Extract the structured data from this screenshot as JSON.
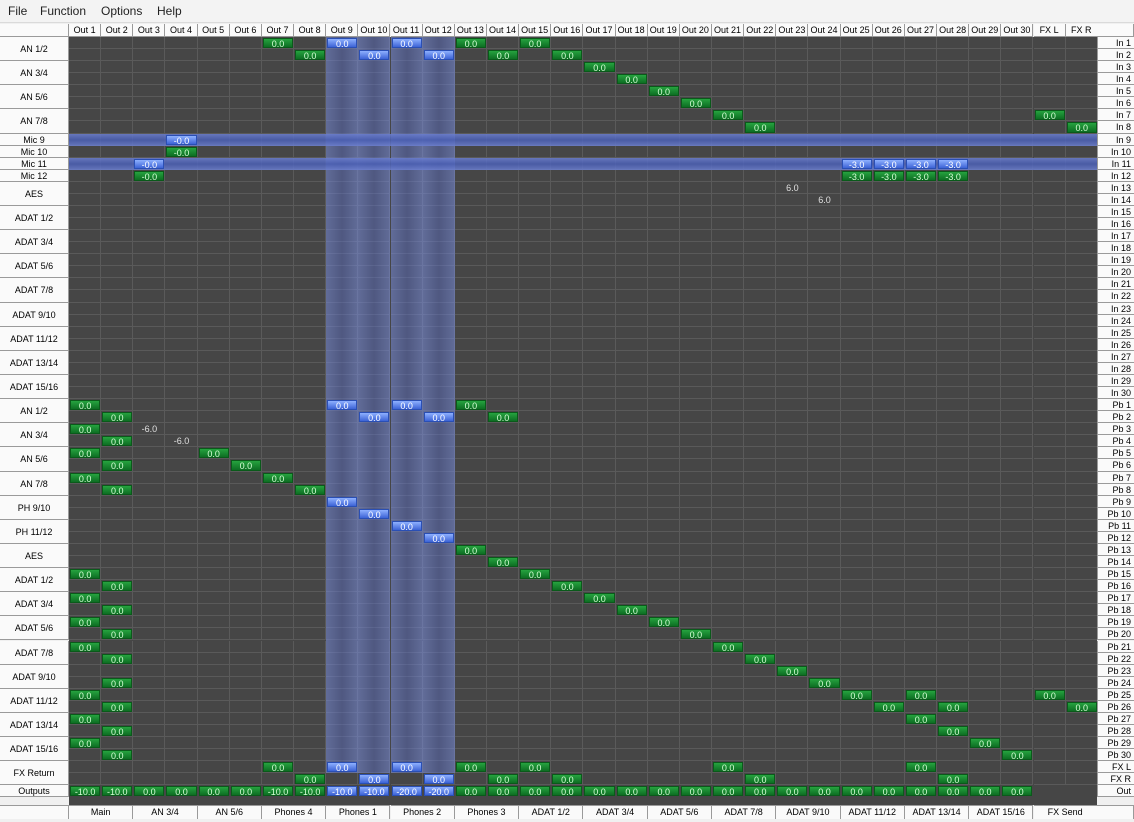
{
  "menu": [
    "File",
    "Function",
    "Options",
    "Help"
  ],
  "outputs": [
    "Out 1",
    "Out 2",
    "Out 3",
    "Out 4",
    "Out 5",
    "Out 6",
    "Out 7",
    "Out 8",
    "Out 9",
    "Out 10",
    "Out 11",
    "Out 12",
    "Out 13",
    "Out 14",
    "Out 15",
    "Out 16",
    "Out 17",
    "Out 18",
    "Out 19",
    "Out 20",
    "Out 21",
    "Out 22",
    "Out 23",
    "Out 24",
    "Out 25",
    "Out 26",
    "Out 27",
    "Out 28",
    "Out 29",
    "Out 30",
    "FX L",
    "FX R"
  ],
  "input_groups": [
    "AN 1/2",
    "AN 3/4",
    "AN 5/6",
    "AN 7/8",
    "Mic 9",
    "Mic 10",
    "Mic 11",
    "Mic 12",
    "AES",
    "ADAT 1/2",
    "ADAT 3/4",
    "ADAT 5/6",
    "ADAT 7/8",
    "ADAT 9/10",
    "ADAT 11/12",
    "ADAT 13/14",
    "ADAT 15/16"
  ],
  "playback_groups": [
    "AN 1/2",
    "AN 3/4",
    "AN 5/6",
    "AN 7/8",
    "PH 9/10",
    "PH 11/12",
    "AES",
    "ADAT 1/2",
    "ADAT 3/4",
    "ADAT 5/6",
    "ADAT 7/8",
    "ADAT 9/10",
    "ADAT 11/12",
    "ADAT 13/14",
    "ADAT 15/16"
  ],
  "fx_return_label": "FX Return",
  "outputs_label": "Outputs",
  "in_rows": [
    "In 1",
    "In 2",
    "In 3",
    "In 4",
    "In 5",
    "In 6",
    "In 7",
    "In 8",
    "In 9",
    "In 10",
    "In 11",
    "In 12",
    "In 13",
    "In 14",
    "In 15",
    "In 16",
    "In 17",
    "In 18",
    "In 19",
    "In 20",
    "In 21",
    "In 22",
    "In 23",
    "In 24",
    "In 25",
    "In 26",
    "In 27",
    "In 28",
    "In 29",
    "In 30"
  ],
  "pb_rows": [
    "Pb 1",
    "Pb 2",
    "Pb 3",
    "Pb 4",
    "Pb 5",
    "Pb 6",
    "Pb 7",
    "Pb 8",
    "Pb 9",
    "Pb 10",
    "Pb 11",
    "Pb 12",
    "Pb 13",
    "Pb 14",
    "Pb 15",
    "Pb 16",
    "Pb 17",
    "Pb 18",
    "Pb 19",
    "Pb 20",
    "Pb 21",
    "Pb 22",
    "Pb 23",
    "Pb 24",
    "Pb 25",
    "Pb 26",
    "Pb 27",
    "Pb 28",
    "Pb 29",
    "Pb 30"
  ],
  "fx_rows": [
    "FX L",
    "FX R"
  ],
  "out_row_label": "Out",
  "output_levels": [
    "-10.0",
    "-10.0",
    "0.0",
    "0.0",
    "0.0",
    "0.0",
    "-10.0",
    "-10.0",
    "-10.0",
    "-10.0",
    "-20.0",
    "-20.0",
    "0.0",
    "0.0",
    "0.0",
    "0.0",
    "0.0",
    "0.0",
    "0.0",
    "0.0",
    "0.0",
    "0.0",
    "0.0",
    "0.0",
    "0.0",
    "0.0",
    "0.0",
    "0.0",
    "0.0",
    "0.0"
  ],
  "bottom_groups": [
    "Main",
    "AN 3/4",
    "AN 5/6",
    "Phones 4",
    "Phones 1",
    "Phones 2",
    "Phones 3",
    "ADAT 1/2",
    "ADAT 3/4",
    "ADAT 5/6",
    "ADAT 7/8",
    "ADAT 9/10",
    "ADAT 11/12",
    "ADAT 13/14",
    "ADAT 15/16",
    "FX Send"
  ],
  "highlighted_output_columns": [
    9,
    10,
    11,
    12
  ],
  "highlighted_input_rows": [
    "In 9",
    "In 11"
  ],
  "gains": [
    {
      "row": "In 1",
      "col": 7,
      "val": "0.0"
    },
    {
      "row": "In 1",
      "col": 9,
      "val": "0.0"
    },
    {
      "row": "In 1",
      "col": 11,
      "val": "0.0"
    },
    {
      "row": "In 1",
      "col": 13,
      "val": "0.0"
    },
    {
      "row": "In 1",
      "col": 15,
      "val": "0.0"
    },
    {
      "row": "In 2",
      "col": 8,
      "val": "0.0"
    },
    {
      "row": "In 2",
      "col": 10,
      "val": "0.0"
    },
    {
      "row": "In 2",
      "col": 12,
      "val": "0.0"
    },
    {
      "row": "In 2",
      "col": 14,
      "val": "0.0"
    },
    {
      "row": "In 2",
      "col": 16,
      "val": "0.0"
    },
    {
      "row": "In 3",
      "col": 17,
      "val": "0.0"
    },
    {
      "row": "In 4",
      "col": 18,
      "val": "0.0"
    },
    {
      "row": "In 5",
      "col": 19,
      "val": "0.0"
    },
    {
      "row": "In 6",
      "col": 20,
      "val": "0.0"
    },
    {
      "row": "In 7",
      "col": 21,
      "val": "0.0"
    },
    {
      "row": "In 7",
      "col": 31,
      "val": "0.0"
    },
    {
      "row": "In 8",
      "col": 22,
      "val": "0.0"
    },
    {
      "row": "In 8",
      "col": 32,
      "val": "0.0"
    },
    {
      "row": "In 9",
      "col": 4,
      "val": "-0.0"
    },
    {
      "row": "In 10",
      "col": 4,
      "val": "-0.0"
    },
    {
      "row": "In 11",
      "col": 3,
      "val": "-0.0"
    },
    {
      "row": "In 11",
      "col": 25,
      "val": "-3.0"
    },
    {
      "row": "In 11",
      "col": 26,
      "val": "-3.0"
    },
    {
      "row": "In 11",
      "col": 27,
      "val": "-3.0"
    },
    {
      "row": "In 11",
      "col": 28,
      "val": "-3.0"
    },
    {
      "row": "In 12",
      "col": 3,
      "val": "-0.0"
    },
    {
      "row": "In 12",
      "col": 25,
      "val": "-3.0"
    },
    {
      "row": "In 12",
      "col": 26,
      "val": "-3.0"
    },
    {
      "row": "In 12",
      "col": 27,
      "val": "-3.0"
    },
    {
      "row": "In 12",
      "col": 28,
      "val": "-3.0"
    },
    {
      "row": "In 13",
      "col": 23,
      "val": "6.0"
    },
    {
      "row": "In 14",
      "col": 24,
      "val": "6.0"
    },
    {
      "row": "Pb 1",
      "col": 1,
      "val": "0.0"
    },
    {
      "row": "Pb 1",
      "col": 9,
      "val": "0.0"
    },
    {
      "row": "Pb 1",
      "col": 11,
      "val": "0.0"
    },
    {
      "row": "Pb 1",
      "col": 13,
      "val": "0.0"
    },
    {
      "row": "Pb 2",
      "col": 2,
      "val": "0.0"
    },
    {
      "row": "Pb 2",
      "col": 10,
      "val": "0.0"
    },
    {
      "row": "Pb 2",
      "col": 12,
      "val": "0.0"
    },
    {
      "row": "Pb 2",
      "col": 14,
      "val": "0.0"
    },
    {
      "row": "Pb 3",
      "col": 1,
      "val": "0.0"
    },
    {
      "row": "Pb 3",
      "col": 3,
      "val": "-6.0"
    },
    {
      "row": "Pb 4",
      "col": 2,
      "val": "0.0"
    },
    {
      "row": "Pb 4",
      "col": 4,
      "val": "-6.0"
    },
    {
      "row": "Pb 5",
      "col": 1,
      "val": "0.0"
    },
    {
      "row": "Pb 5",
      "col": 5,
      "val": "0.0"
    },
    {
      "row": "Pb 6",
      "col": 2,
      "val": "0.0"
    },
    {
      "row": "Pb 6",
      "col": 6,
      "val": "0.0"
    },
    {
      "row": "Pb 7",
      "col": 1,
      "val": "0.0"
    },
    {
      "row": "Pb 7",
      "col": 7,
      "val": "0.0"
    },
    {
      "row": "Pb 8",
      "col": 2,
      "val": "0.0"
    },
    {
      "row": "Pb 8",
      "col": 8,
      "val": "0.0"
    },
    {
      "row": "Pb 9",
      "col": 9,
      "val": "0.0"
    },
    {
      "row": "Pb 10",
      "col": 10,
      "val": "0.0"
    },
    {
      "row": "Pb 11",
      "col": 11,
      "val": "0.0"
    },
    {
      "row": "Pb 12",
      "col": 12,
      "val": "0.0"
    },
    {
      "row": "Pb 13",
      "col": 13,
      "val": "0.0"
    },
    {
      "row": "Pb 14",
      "col": 14,
      "val": "0.0"
    },
    {
      "row": "Pb 15",
      "col": 1,
      "val": "0.0"
    },
    {
      "row": "Pb 15",
      "col": 15,
      "val": "0.0"
    },
    {
      "row": "Pb 16",
      "col": 2,
      "val": "0.0"
    },
    {
      "row": "Pb 16",
      "col": 16,
      "val": "0.0"
    },
    {
      "row": "Pb 17",
      "col": 1,
      "val": "0.0"
    },
    {
      "row": "Pb 17",
      "col": 17,
      "val": "0.0"
    },
    {
      "row": "Pb 18",
      "col": 2,
      "val": "0.0"
    },
    {
      "row": "Pb 18",
      "col": 18,
      "val": "0.0"
    },
    {
      "row": "Pb 19",
      "col": 1,
      "val": "0.0"
    },
    {
      "row": "Pb 19",
      "col": 19,
      "val": "0.0"
    },
    {
      "row": "Pb 20",
      "col": 2,
      "val": "0.0"
    },
    {
      "row": "Pb 20",
      "col": 20,
      "val": "0.0"
    },
    {
      "row": "Pb 21",
      "col": 1,
      "val": "0.0"
    },
    {
      "row": "Pb 21",
      "col": 21,
      "val": "0.0"
    },
    {
      "row": "Pb 22",
      "col": 2,
      "val": "0.0"
    },
    {
      "row": "Pb 22",
      "col": 22,
      "val": "0.0"
    },
    {
      "row": "Pb 23",
      "col": 23,
      "val": "0.0"
    },
    {
      "row": "Pb 24",
      "col": 2,
      "val": "0.0"
    },
    {
      "row": "Pb 24",
      "col": 24,
      "val": "0.0"
    },
    {
      "row": "Pb 25",
      "col": 1,
      "val": "0.0"
    },
    {
      "row": "Pb 25",
      "col": 25,
      "val": "0.0"
    },
    {
      "row": "Pb 25",
      "col": 27,
      "val": "0.0"
    },
    {
      "row": "Pb 25",
      "col": 31,
      "val": "0.0"
    },
    {
      "row": "Pb 26",
      "col": 2,
      "val": "0.0"
    },
    {
      "row": "Pb 26",
      "col": 26,
      "val": "0.0"
    },
    {
      "row": "Pb 26",
      "col": 28,
      "val": "0.0"
    },
    {
      "row": "Pb 26",
      "col": 32,
      "val": "0.0"
    },
    {
      "row": "Pb 27",
      "col": 1,
      "val": "0.0"
    },
    {
      "row": "Pb 27",
      "col": 27,
      "val": "0.0"
    },
    {
      "row": "Pb 28",
      "col": 2,
      "val": "0.0"
    },
    {
      "row": "Pb 28",
      "col": 28,
      "val": "0.0"
    },
    {
      "row": "Pb 29",
      "col": 1,
      "val": "0.0"
    },
    {
      "row": "Pb 29",
      "col": 29,
      "val": "0.0"
    },
    {
      "row": "Pb 30",
      "col": 2,
      "val": "0.0"
    },
    {
      "row": "Pb 30",
      "col": 30,
      "val": "0.0"
    },
    {
      "row": "FX L",
      "col": 7,
      "val": "0.0"
    },
    {
      "row": "FX L",
      "col": 9,
      "val": "0.0"
    },
    {
      "row": "FX L",
      "col": 11,
      "val": "0.0"
    },
    {
      "row": "FX L",
      "col": 13,
      "val": "0.0"
    },
    {
      "row": "FX L",
      "col": 15,
      "val": "0.0"
    },
    {
      "row": "FX L",
      "col": 21,
      "val": "0.0"
    },
    {
      "row": "FX L",
      "col": 27,
      "val": "0.0"
    },
    {
      "row": "FX R",
      "col": 8,
      "val": "0.0"
    },
    {
      "row": "FX R",
      "col": 10,
      "val": "0.0"
    },
    {
      "row": "FX R",
      "col": 12,
      "val": "0.0"
    },
    {
      "row": "FX R",
      "col": 14,
      "val": "0.0"
    },
    {
      "row": "FX R",
      "col": 16,
      "val": "0.0"
    },
    {
      "row": "FX R",
      "col": 22,
      "val": "0.0"
    },
    {
      "row": "FX R",
      "col": 28,
      "val": "0.0"
    }
  ],
  "colors": {
    "gain_green": "#1a8a30",
    "gain_blue": "#5a7fe8",
    "grid_bg": "#464646",
    "band": "#6f80d0"
  }
}
